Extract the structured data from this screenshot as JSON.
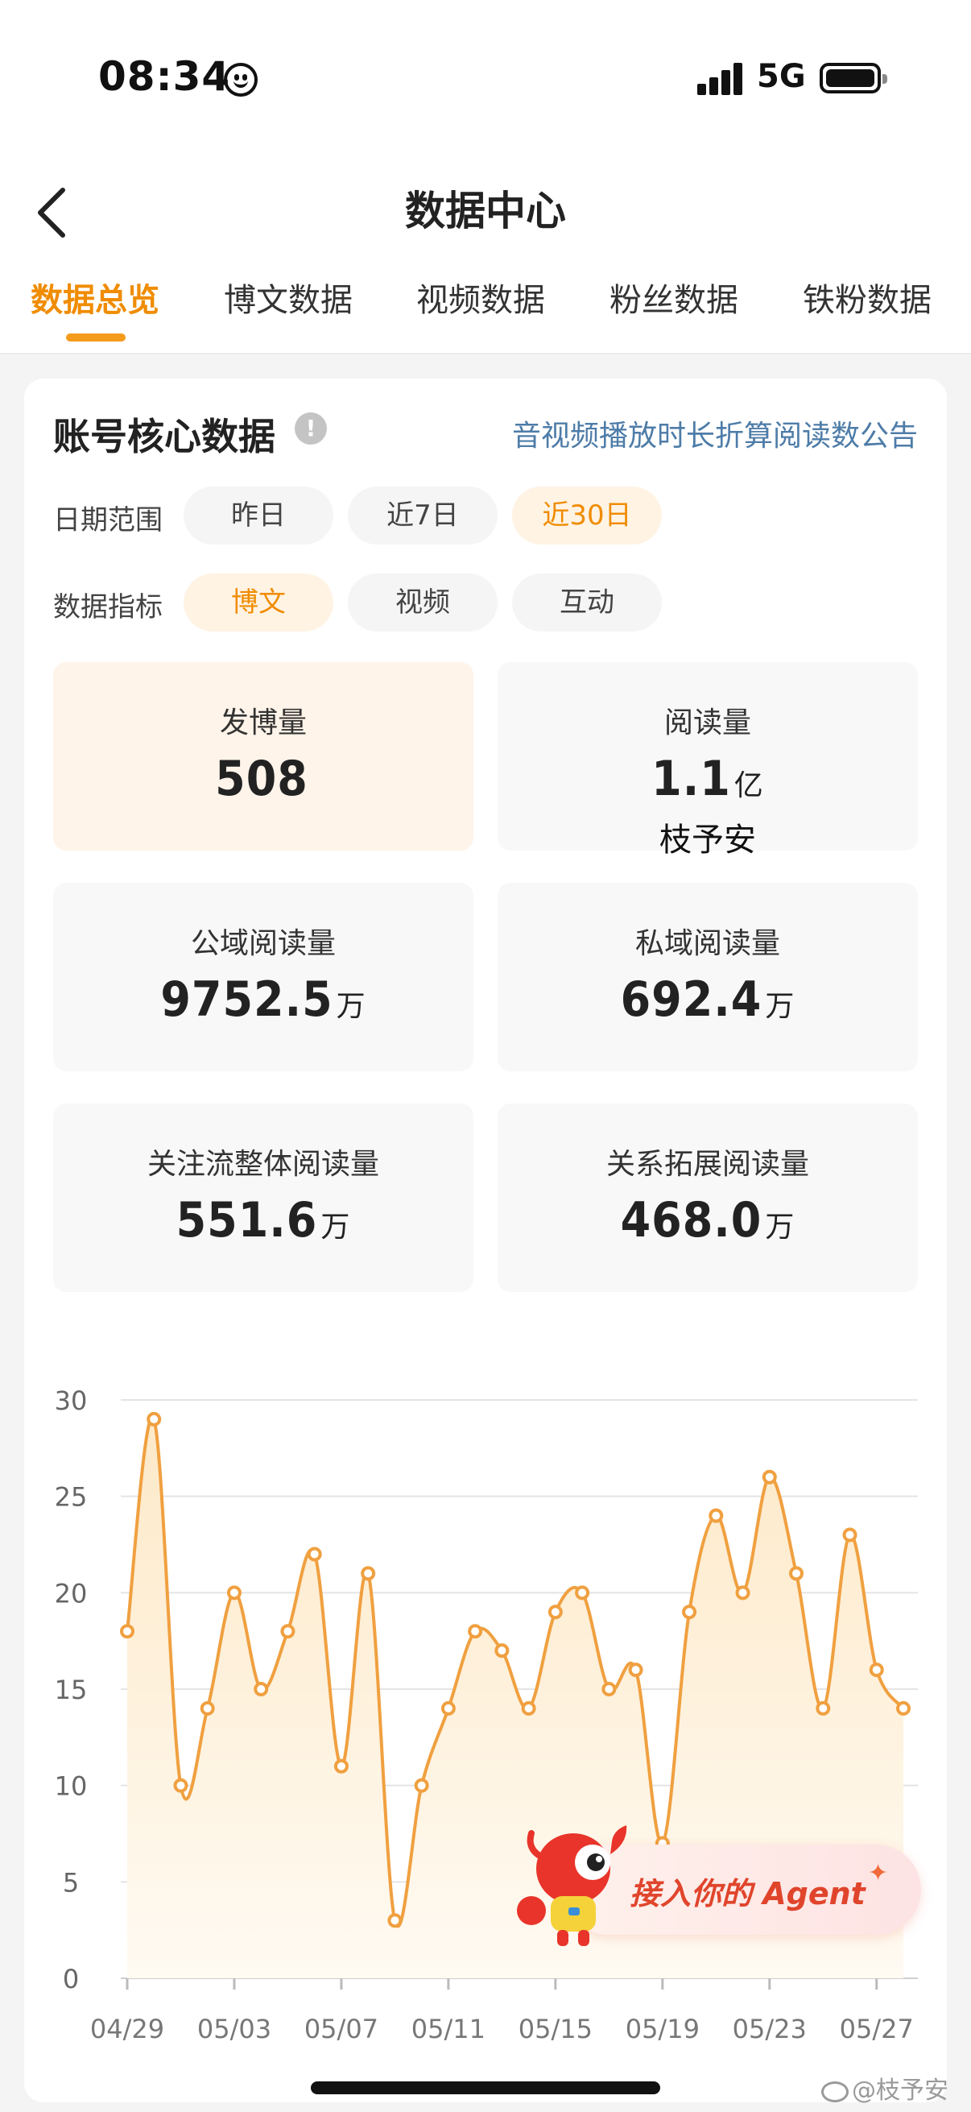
{
  "status_bar": {
    "time": "08:34",
    "network": "5G"
  },
  "nav": {
    "title": "数据中心"
  },
  "tabs": [
    {
      "label": "数据总览",
      "active": true
    },
    {
      "label": "博文数据",
      "active": false
    },
    {
      "label": "视频数据",
      "active": false
    },
    {
      "label": "粉丝数据",
      "active": false
    },
    {
      "label": "铁粉数据",
      "active": false
    }
  ],
  "card": {
    "title": "账号核心数据",
    "info_icon": "!",
    "notice_link": "音视频播放时长折算阅读数公告",
    "date_range": {
      "label": "日期范围",
      "options": [
        "昨日",
        "近7日",
        "近30日"
      ],
      "selected": "近30日"
    },
    "metric": {
      "label": "数据指标",
      "options": [
        "博文",
        "视频",
        "互动"
      ],
      "selected": "博文"
    },
    "stats": [
      {
        "label": "发博量",
        "value": "508",
        "unit": "",
        "active": true
      },
      {
        "label": "阅读量",
        "value": "1.1",
        "unit": "亿",
        "active": false
      },
      {
        "label": "公域阅读量",
        "value": "9752.5",
        "unit": "万",
        "active": false
      },
      {
        "label": "私域阅读量",
        "value": "692.4",
        "unit": "万",
        "active": false
      },
      {
        "label": "关注流整体阅读量",
        "value": "551.6",
        "unit": "万",
        "active": false
      },
      {
        "label": "关系拓展阅读量",
        "value": "468.0",
        "unit": "万",
        "active": false
      }
    ],
    "overlay_name": "枝予安"
  },
  "chart_data": {
    "type": "area",
    "x": [
      "04/29",
      "04/30",
      "05/01",
      "05/02",
      "05/03",
      "05/04",
      "05/05",
      "05/06",
      "05/07",
      "05/08",
      "05/09",
      "05/10",
      "05/11",
      "05/12",
      "05/13",
      "05/14",
      "05/15",
      "05/16",
      "05/17",
      "05/18",
      "05/19",
      "05/20",
      "05/21",
      "05/22",
      "05/23",
      "05/24",
      "05/25",
      "05/26",
      "05/27",
      "05/28"
    ],
    "values": [
      18,
      29,
      10,
      14,
      20,
      15,
      18,
      22,
      11,
      21,
      3,
      10,
      14,
      18,
      17,
      14,
      19,
      20,
      15,
      16,
      7,
      19,
      24,
      20,
      26,
      21,
      14,
      23,
      16,
      14
    ],
    "xtick_labels": [
      "04/29",
      "05/03",
      "05/07",
      "05/11",
      "05/15",
      "05/19",
      "05/23",
      "05/27"
    ],
    "yticks": [
      0,
      5,
      10,
      15,
      20,
      25,
      30
    ],
    "ylim": [
      0,
      30
    ],
    "title": "",
    "xlabel": "",
    "ylabel": "",
    "grid": true,
    "colors": {
      "line": "#f0a040",
      "fill_top": "#fde9c8",
      "fill_bottom": "#fffaf2",
      "point_fill": "#ffffff"
    }
  },
  "agent_banner": {
    "text": "接入你的 Agent"
  },
  "watermark": {
    "text": "@枝予安"
  },
  "colors": {
    "accent": "#f08c00",
    "link": "#4e7ca8",
    "active_bg": "#fff4ea"
  }
}
